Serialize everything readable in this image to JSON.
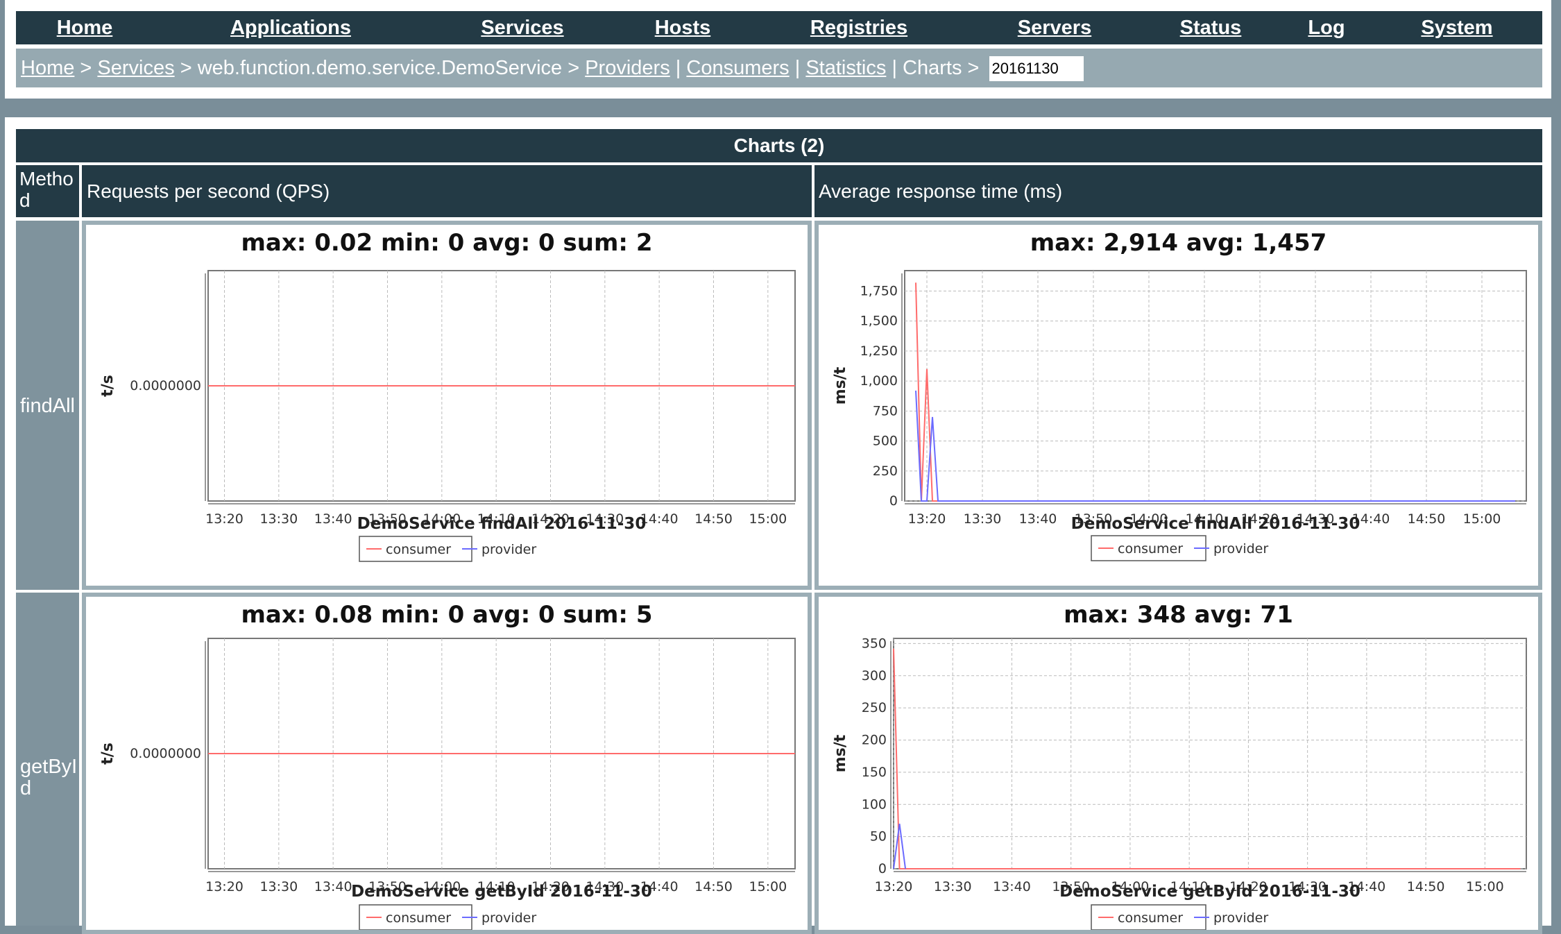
{
  "nav": {
    "items": [
      {
        "label": "Home"
      },
      {
        "label": "Applications"
      },
      {
        "label": "Services"
      },
      {
        "label": "Hosts"
      },
      {
        "label": "Registries"
      },
      {
        "label": "Servers"
      },
      {
        "label": "Status"
      },
      {
        "label": "Log"
      },
      {
        "label": "System"
      }
    ]
  },
  "breadcrumb": {
    "home": "Home",
    "services": "Services",
    "service": "web.function.demo.service.DemoService",
    "providers": "Providers",
    "consumers": "Consumers",
    "statistics": "Statistics",
    "charts": "Charts",
    "date_value": "20161130"
  },
  "table": {
    "title": "Charts (2)",
    "columns": [
      "Metho d",
      "Requests per second (QPS)",
      "Average response time (ms)"
    ],
    "rows": [
      {
        "method": "findAll",
        "qps_title": "max: 0.02 min: 0 avg: 0 sum: 2",
        "rt_title": "max: 2,914 avg: 1,457",
        "qps_xlabel": "DemoService  findAll  2016-11-30",
        "rt_xlabel": "DemoService  findAll  2016-11-30"
      },
      {
        "method": "getById",
        "qps_title": "max: 0.08 min: 0 avg: 0 sum: 5",
        "rt_title": "max: 348 avg: 71",
        "qps_xlabel": "DemoService  getById  2016-11-30",
        "rt_xlabel": "DemoService  getById  2016-11-30"
      }
    ]
  },
  "colors": {
    "consumer": "#ff6b6b",
    "provider": "#6b6bff",
    "header_bg": "#233a45"
  },
  "chart_data": [
    {
      "type": "line",
      "title": "max: 0.02 min: 0 avg: 0 sum: 2",
      "xlabel": "DemoService  findAll  2016-11-30",
      "ylabel": "t/s",
      "x_ticks": [
        "13:20",
        "13:30",
        "13:40",
        "13:50",
        "14:00",
        "14:10",
        "14:20",
        "14:30",
        "14:40",
        "14:50",
        "15:00"
      ],
      "y_ticks": [
        "0.0000000"
      ],
      "xlim": [
        "13:17",
        "15:05"
      ],
      "ylim": [
        -1,
        1
      ],
      "legend": [
        "consumer",
        "provider"
      ],
      "legend_position": "bottom",
      "grid": true,
      "series": [
        {
          "name": "consumer",
          "x": [
            "13:17",
            "15:05"
          ],
          "y": [
            0,
            0
          ]
        }
      ]
    },
    {
      "type": "line",
      "title": "max: 2,914 avg: 1,457",
      "xlabel": "DemoService  findAll  2016-11-30",
      "ylabel": "ms/t",
      "x_ticks": [
        "13:20",
        "13:30",
        "13:40",
        "13:50",
        "14:00",
        "14:10",
        "14:20",
        "14:30",
        "14:40",
        "14:50",
        "15:00"
      ],
      "y_ticks": [
        0,
        250,
        500,
        750,
        1000,
        1250,
        1500,
        1750
      ],
      "y_tick_labels": [
        "0",
        "250",
        "500",
        "750",
        "1,000",
        "1,250",
        "1,500",
        "1,750"
      ],
      "xlim": [
        "13:16",
        "15:08"
      ],
      "ylim": [
        0,
        1920
      ],
      "legend": [
        "consumer",
        "provider"
      ],
      "legend_position": "bottom",
      "grid": true,
      "series": [
        {
          "name": "consumer",
          "x": [
            "13:18",
            "13:19",
            "13:20",
            "13:21",
            "13:22",
            "15:06"
          ],
          "y": [
            1820,
            0,
            1100,
            0,
            0,
            0
          ]
        },
        {
          "name": "provider",
          "x": [
            "13:18",
            "13:19",
            "13:20",
            "13:21",
            "13:22",
            "15:06"
          ],
          "y": [
            920,
            0,
            0,
            700,
            0,
            0
          ]
        }
      ]
    },
    {
      "type": "line",
      "title": "max: 0.08 min: 0 avg: 0 sum: 5",
      "xlabel": "DemoService  getById  2016-11-30",
      "ylabel": "t/s",
      "x_ticks": [
        "13:20",
        "13:30",
        "13:40",
        "13:50",
        "14:00",
        "14:10",
        "14:20",
        "14:30",
        "14:40",
        "14:50",
        "15:00"
      ],
      "y_ticks": [
        "0.0000000"
      ],
      "xlim": [
        "13:17",
        "15:05"
      ],
      "ylim": [
        -1,
        1
      ],
      "legend": [
        "consumer",
        "provider"
      ],
      "legend_position": "bottom",
      "grid": true,
      "series": [
        {
          "name": "consumer",
          "x": [
            "13:17",
            "15:05"
          ],
          "y": [
            0,
            0
          ]
        }
      ]
    },
    {
      "type": "line",
      "title": "max: 348 avg: 71",
      "xlabel": "DemoService  getById  2016-11-30",
      "ylabel": "ms/t",
      "x_ticks": [
        "13:20",
        "13:30",
        "13:40",
        "13:50",
        "14:00",
        "14:10",
        "14:20",
        "14:30",
        "14:40",
        "14:50",
        "15:00"
      ],
      "y_ticks": [
        0,
        50,
        100,
        150,
        200,
        250,
        300,
        350
      ],
      "y_tick_labels": [
        "0",
        "50",
        "100",
        "150",
        "200",
        "250",
        "300",
        "350"
      ],
      "xlim": [
        "13:20",
        "15:07"
      ],
      "ylim": [
        0,
        358
      ],
      "legend": [
        "consumer",
        "provider"
      ],
      "legend_position": "bottom",
      "grid": true,
      "series": [
        {
          "name": "consumer",
          "x": [
            "13:20",
            "13:21",
            "15:06"
          ],
          "y": [
            342,
            0,
            0
          ]
        },
        {
          "name": "provider",
          "x": [
            "13:20",
            "13:21",
            "13:22"
          ],
          "y": [
            0,
            70,
            0
          ]
        }
      ]
    }
  ]
}
